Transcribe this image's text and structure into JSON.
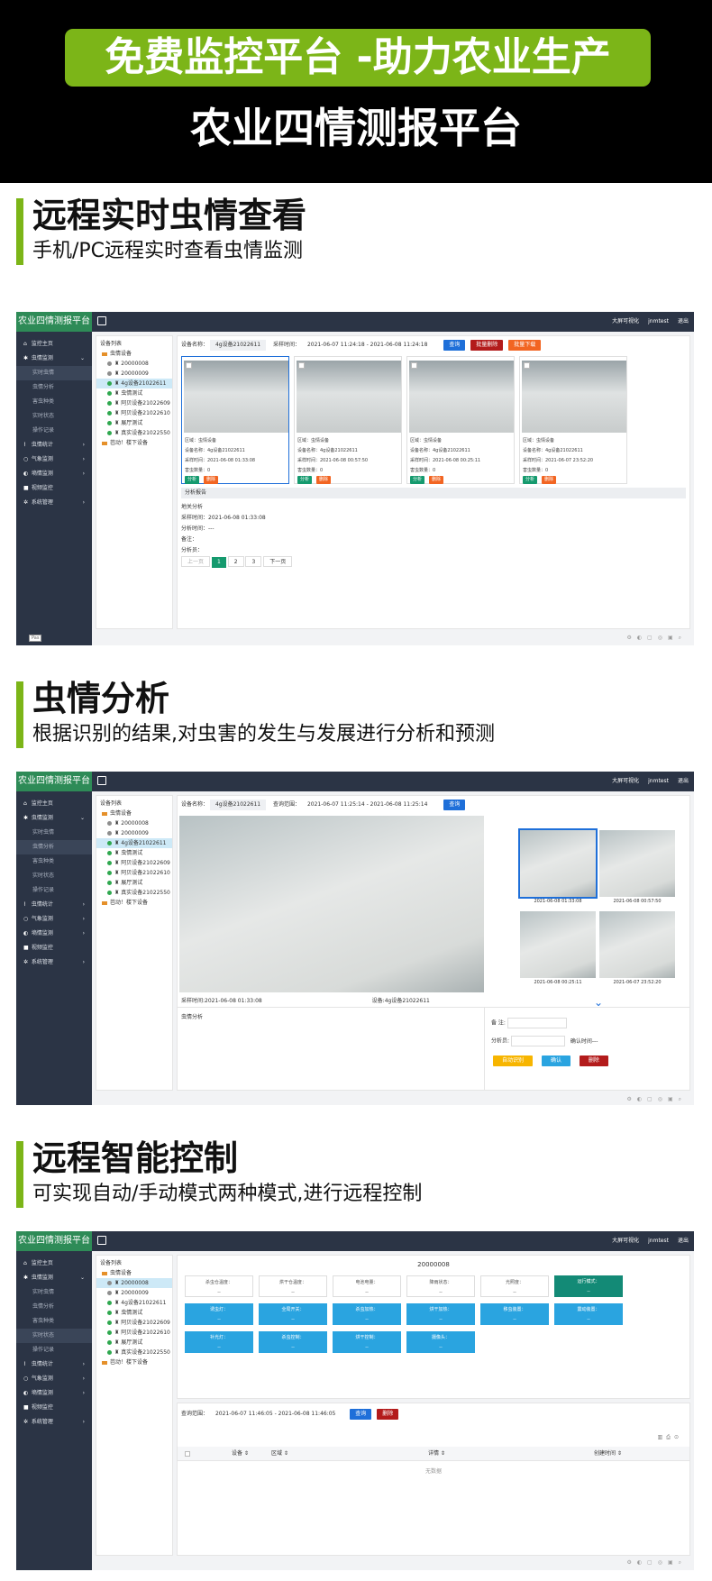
{
  "banner": {
    "pill": "免费监控平台 -助力农业生产",
    "title": "农业四情测报平台"
  },
  "platform_title": "农业四情测报平台",
  "topbar": [
    "大屏可视化",
    "jnmtest",
    "退出"
  ],
  "sidebar": [
    {
      "icon": "home-icon",
      "glyph": "⌂",
      "label": "监控主页"
    },
    {
      "icon": "bug-icon",
      "glyph": "✱",
      "label": "虫情监测",
      "arrow": "⌄"
    },
    {
      "label": "实时虫情",
      "sub": true
    },
    {
      "label": "虫情分析",
      "sub": true
    },
    {
      "label": "害虫种类",
      "sub": true
    },
    {
      "label": "实时状态",
      "sub": true
    },
    {
      "label": "操作记录",
      "sub": true
    },
    {
      "icon": "chart-icon",
      "glyph": "⌇",
      "label": "虫情统计",
      "arrow": "›"
    },
    {
      "icon": "weather-icon",
      "glyph": "○",
      "label": "气象监测",
      "arrow": "›"
    },
    {
      "icon": "soil-icon",
      "glyph": "◐",
      "label": "墒情监测",
      "arrow": "›"
    },
    {
      "icon": "video-icon",
      "glyph": "■",
      "label": "视频监控"
    },
    {
      "icon": "gear-icon",
      "glyph": "✲",
      "label": "系统管理",
      "arrow": "›"
    }
  ],
  "tree": {
    "title": "设备列表",
    "root": "虫情设备",
    "items": [
      {
        "label": "20000008",
        "status": "gray"
      },
      {
        "label": "20000009",
        "status": "gray"
      },
      {
        "label": "4g设备21022611",
        "status": "green"
      },
      {
        "label": "虫情测试",
        "status": "green"
      },
      {
        "label": "阿贝设备21022609",
        "status": "green"
      },
      {
        "label": "阿贝设备21022610",
        "status": "green"
      },
      {
        "label": "展厅测试",
        "status": "green"
      },
      {
        "label": "真实设备21022550",
        "status": "green"
      }
    ],
    "footer": "芭动！楼下设备"
  },
  "sections": [
    {
      "title": "远程实时虫情查看",
      "subtitle": "手机/PC远程实时查看虫情监测"
    },
    {
      "title": "虫情分析",
      "subtitle": "根据识别的结果,对虫害的发生与发展进行分析和预测"
    },
    {
      "title": "远程智能控制",
      "subtitle": "可实现自动/手动模式两种模式,进行远程控制"
    }
  ],
  "shot1": {
    "device_label": "设备名称：",
    "device_value": "4g设备21022611",
    "time_label": "采样时间：",
    "time_value": "2021-06-07 11:24:18 - 2021-06-08 11:24:18",
    "btn_query": "查询",
    "btn_delete": "批量删除",
    "btn_download": "批量下载",
    "cards": [
      {
        "region": "区域：虫情设备",
        "device": "设备名称：4g设备21022611",
        "time": "采样时间：2021-06-08 01:33:08",
        "count": "害虫数量：0"
      },
      {
        "region": "区域：虫情设备",
        "device": "设备名称：4g设备21022611",
        "time": "采样时间：2021-06-08 00:57:50",
        "count": "害虫数量：0"
      },
      {
        "region": "区域：虫情设备",
        "device": "设备名称：4g设备21022611",
        "time": "采样时间：2021-06-08 00:25:11",
        "count": "害虫数量：0"
      },
      {
        "region": "区域：虫情设备",
        "device": "设备名称：4g设备21022611",
        "time": "采样时间：2021-06-07 23:52:20",
        "count": "害虫数量：0"
      }
    ],
    "card_btn_analyze": "分析",
    "card_btn_delete": "删除",
    "report_title": "分析报告",
    "report_lines": [
      "地关分析",
      "采样时间：2021-06-08 01:33:08",
      "分析时间：---",
      "备注：",
      "分析员："
    ],
    "pager": [
      "上一页",
      "1",
      "2",
      "3",
      "下一页"
    ],
    "corner": "Pas"
  },
  "shot2": {
    "device_label": "设备名称：",
    "device_value": "4g设备21022611",
    "range_label": "查询范围：",
    "range_value": "2021-06-07 11:25:14 - 2021-06-08 11:25:14",
    "btn_query": "查询",
    "caption_time": "采样时间:2021-06-08 01:33:08",
    "caption_device": "设备:4g设备21022611",
    "thumbs": [
      "2021-06-08 01:33:08",
      "2021-06-08 00:57:50",
      "2021-06-08 00:25:11",
      "2021-06-07 23:52:20"
    ],
    "analysis_label": "虫情分析",
    "remark_label": "备 注:",
    "analyst_label": "分析员:",
    "confirm_time": "确认时间---",
    "btn_auto": "自动识别",
    "btn_confirm": "确认",
    "btn_delete": "删除"
  },
  "shot3": {
    "device_id": "20000008",
    "status_row": [
      {
        "label": "杀虫仓温度：",
        "value": "--"
      },
      {
        "label": "烘干仓温度：",
        "value": "--"
      },
      {
        "label": "电池电量：",
        "value": "--"
      },
      {
        "label": "降雨状态：",
        "value": "--"
      },
      {
        "label": "光照度：",
        "value": "--"
      },
      {
        "label": "运行模式：",
        "value": "--"
      }
    ],
    "control_row1": [
      {
        "label": "诱虫灯：",
        "value": "--"
      },
      {
        "label": "全局开关：",
        "value": "--"
      },
      {
        "label": "杀虫加热：",
        "value": "--"
      },
      {
        "label": "烘干加热：",
        "value": "--"
      },
      {
        "label": "移虫装置：",
        "value": "--"
      },
      {
        "label": "震动装置：",
        "value": "--"
      }
    ],
    "control_row2": [
      {
        "label": "补光灯：",
        "value": "--"
      },
      {
        "label": "杀虫控制：",
        "value": "--"
      },
      {
        "label": "烘干控制：",
        "value": "--"
      },
      {
        "label": "摄像头：",
        "value": "--"
      }
    ],
    "range_label": "查询范围：",
    "range_value": "2021-06-07 11:46:05 - 2021-06-08 11:46:05",
    "btn_query": "查询",
    "btn_delete": "删除",
    "columns": [
      "设备 ⇕",
      "区域 ⇕",
      "详情 ⇕",
      "创建时间 ⇕"
    ],
    "empty": "无数据"
  },
  "colors": {
    "accent_green": "#7cb518",
    "nav_dark": "#2b3445",
    "logo_green": "#2e8b57"
  }
}
